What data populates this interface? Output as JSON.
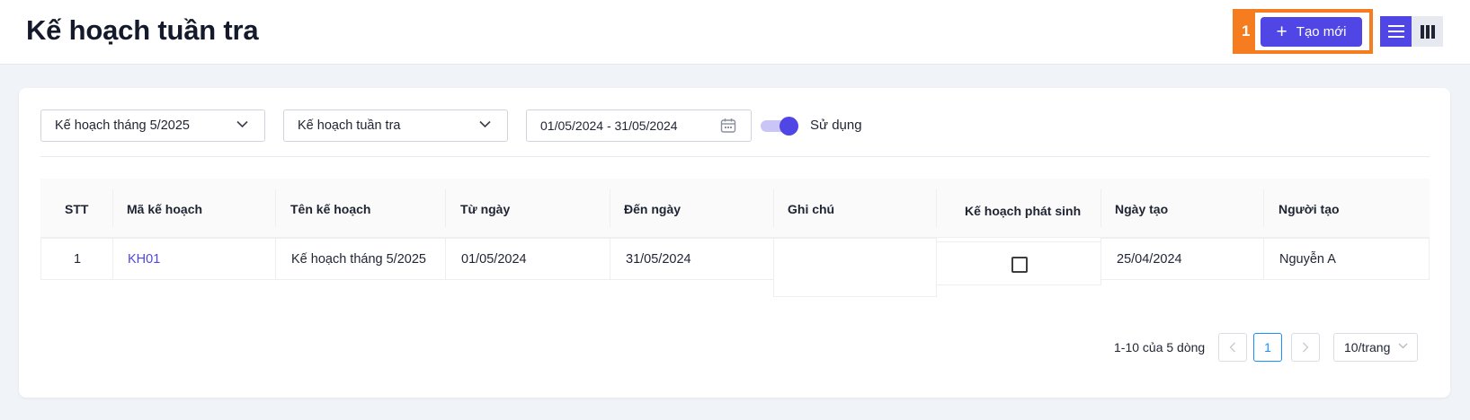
{
  "header": {
    "title": "Kế hoạch tuần tra",
    "highlight_number": "1",
    "create_button_label": "Tạo mới"
  },
  "filters": {
    "plan_month": "Kế hoạch tháng 5/2025",
    "plan_type": "Kế hoạch tuần tra",
    "date_range": "01/05/2024 - 31/05/2024",
    "active_toggle_label": "Sử dụng",
    "active_toggle_on": true
  },
  "table": {
    "columns": [
      "STT",
      "Mã kế hoạch",
      "Tên kế hoạch",
      "Từ ngày",
      "Đến ngày",
      "Ghi chú",
      "Kế hoạch phát sinh",
      "Ngày tạo",
      "Người tạo"
    ],
    "rows": [
      {
        "stt": "1",
        "code": "KH01",
        "name": "Kế hoạch tháng 5/2025",
        "from": "01/05/2024",
        "to": "31/05/2024",
        "note": "",
        "incidental": false,
        "created": "25/04/2024",
        "creator": "Nguyễn A"
      }
    ]
  },
  "pagination": {
    "info": "1-10 của 5 dòng",
    "current_page": "1",
    "page_size": "10/trang"
  },
  "colors": {
    "primary": "#5046e5",
    "highlight": "#f57c1f",
    "page_link": "#1890ff"
  }
}
